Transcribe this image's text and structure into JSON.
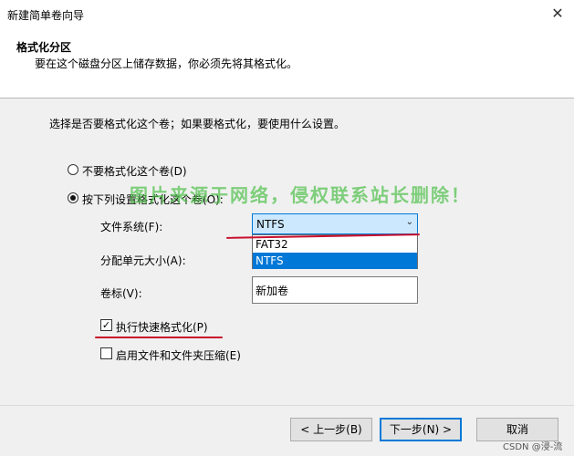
{
  "window": {
    "title": "新建简单卷向导"
  },
  "header": {
    "title": "格式化分区",
    "description": "要在这个磁盘分区上储存数据，你必须先将其格式化。"
  },
  "main": {
    "prompt": "选择是否要格式化这个卷；如果要格式化，要使用什么设置。",
    "radio_no_format": "不要格式化这个卷(D)",
    "radio_format": "按下列设置格式化这个卷(O):",
    "file_system_label": "文件系统(F):",
    "file_system_value": "NTFS",
    "file_system_options": [
      "FAT32",
      "NTFS"
    ],
    "alloc_unit_label": "分配单元大小(A):",
    "volume_label_label": "卷标(V):",
    "volume_label_value": "新加卷",
    "quick_format_label": "执行快速格式化(P)",
    "quick_format_checked": true,
    "compression_label": "启用文件和文件夹压缩(E)",
    "compression_checked": false
  },
  "footer": {
    "back": "< 上一步(B)",
    "next": "下一步(N) >",
    "cancel": "取消"
  },
  "watermark": "图片来源于网络，侵权联系站长删除！",
  "csdn_mark": "CSDN @浸-流",
  "colors": {
    "accent": "#0078d7",
    "annotation": "#c8102e",
    "watermark": "#4fc04a"
  }
}
